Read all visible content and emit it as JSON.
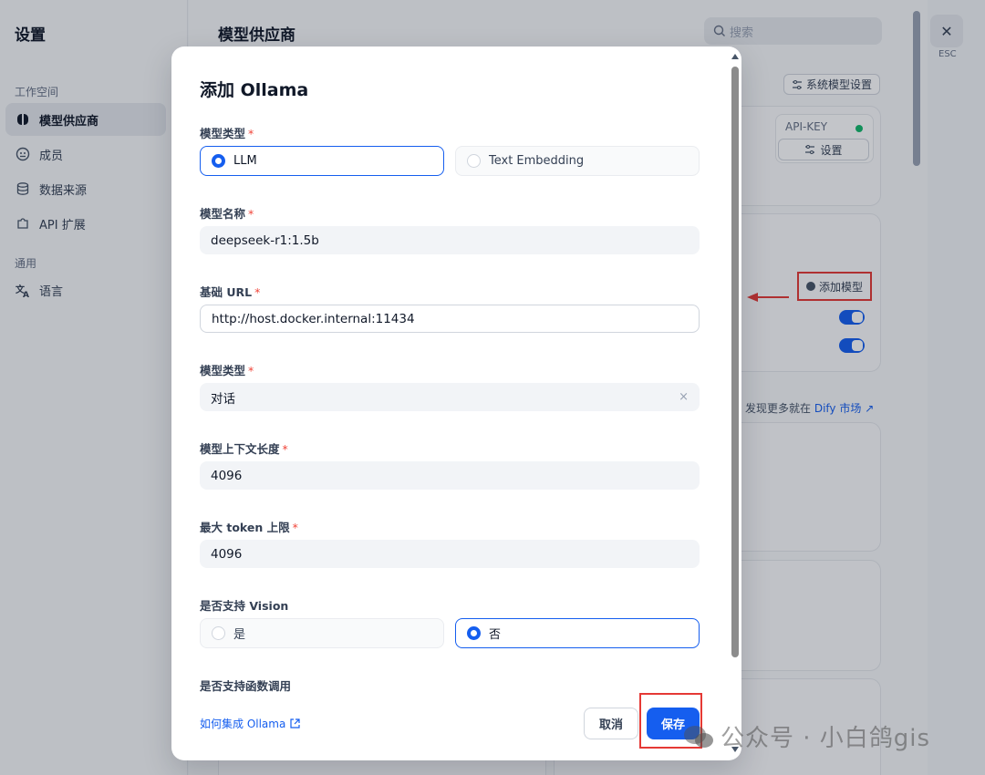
{
  "sidebar": {
    "title": "设置",
    "workspace_group": "工作空间",
    "general_group": "通用",
    "items": [
      {
        "label": "模型供应商",
        "icon": "brain-icon"
      },
      {
        "label": "成员",
        "icon": "members-icon"
      },
      {
        "label": "数据来源",
        "icon": "database-icon"
      },
      {
        "label": "API 扩展",
        "icon": "puzzle-icon"
      }
    ],
    "language_label": "语言"
  },
  "main": {
    "page_title": "模型供应商",
    "search_placeholder": "搜索",
    "system_model_settings": "系统模型设置",
    "api_key_label": "API-KEY",
    "settings_button": "设置",
    "add_model": "添加模型",
    "market_text": "发现更多就在",
    "market_link": "Dify 市场",
    "market_arrow": "↗"
  },
  "esc": {
    "icon": "close-icon",
    "label": "ESC",
    "symbol": "✕"
  },
  "modal": {
    "title": "添加 Ollama",
    "required_mark": "*",
    "model_type_label": "模型类型",
    "model_type_options": [
      "LLM",
      "Text Embedding"
    ],
    "model_type_selected": "LLM",
    "model_name_label": "模型名称",
    "model_name_value": "deepseek-r1:1.5b",
    "base_url_label": "基础 URL",
    "base_url_value": "http://host.docker.internal:11434",
    "mode_label": "模型类型",
    "mode_value": "对话",
    "clear_symbol": "×",
    "context_size_label": "模型上下文长度",
    "context_size_value": "4096",
    "max_tokens_label": "最大 token 上限",
    "max_tokens_value": "4096",
    "vision_label": "是否支持 Vision",
    "vision_options": [
      "是",
      "否"
    ],
    "vision_selected": "否",
    "function_call_label": "是否支持函数调用",
    "help_link": "如何集成 Ollama",
    "cancel_button": "取消",
    "save_button": "保存"
  },
  "watermark": "公众号 · 小白鸽gis",
  "colors": {
    "accent": "#155eef",
    "annotation_red": "#e53935",
    "required": "#f04438"
  }
}
